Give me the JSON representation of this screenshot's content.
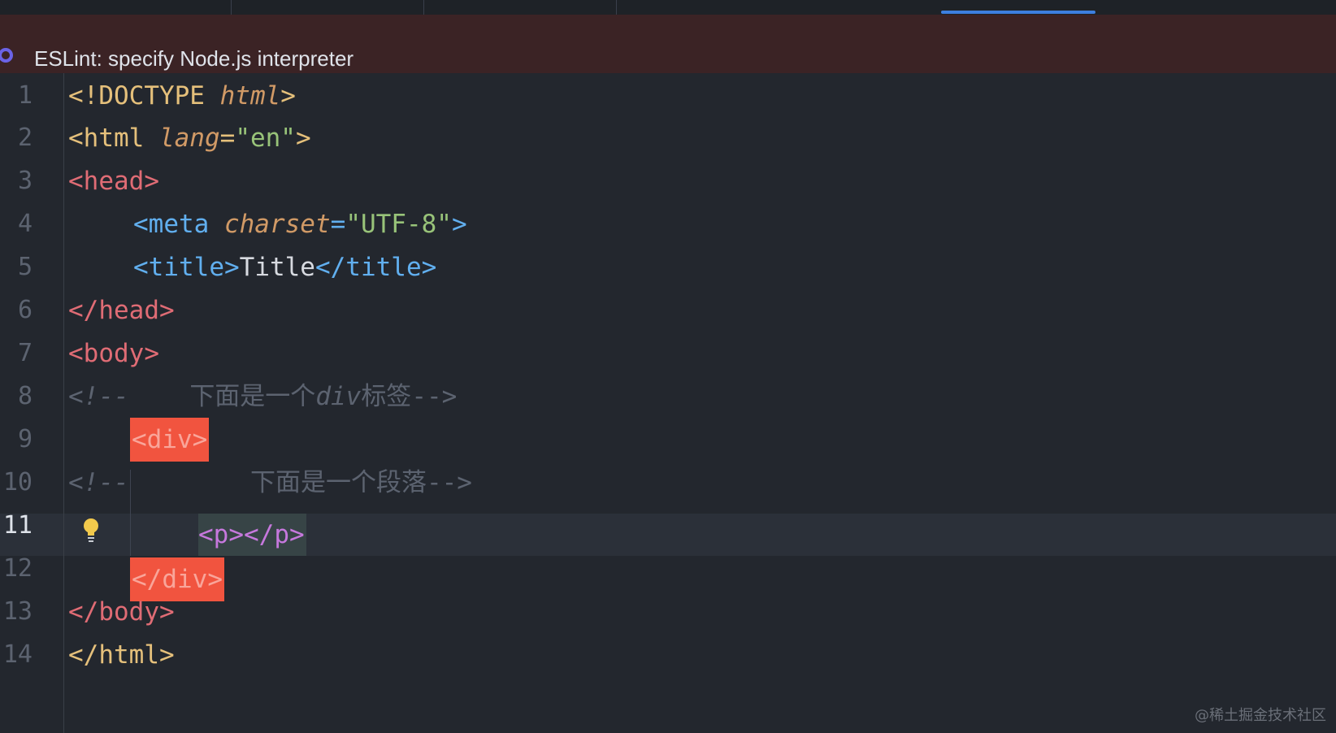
{
  "banner": {
    "message": "ESLint: specify Node.js interpreter",
    "icon": "eslint-icon"
  },
  "editor": {
    "current_line": 11,
    "lines": [
      {
        "number": "1"
      },
      {
        "number": "2"
      },
      {
        "number": "3"
      },
      {
        "number": "4"
      },
      {
        "number": "5"
      },
      {
        "number": "6"
      },
      {
        "number": "7"
      },
      {
        "number": "8"
      },
      {
        "number": "9"
      },
      {
        "number": "10"
      },
      {
        "number": "11"
      },
      {
        "number": "12"
      },
      {
        "number": "13"
      },
      {
        "number": "14"
      }
    ],
    "code": {
      "l1_open": "<!DOCTYPE ",
      "l1_html": "html",
      "l1_close": ">",
      "l2_tag": "<html ",
      "l2_attr": "lang",
      "l2_eq": "=",
      "l2_val": "\"en\"",
      "l2_close": ">",
      "l3": "<head>",
      "l4_tag": "<meta ",
      "l4_attr": "charset",
      "l4_eq": "=",
      "l4_val": "\"UTF-8\"",
      "l4_close": ">",
      "l5_open": "<title>",
      "l5_text": "Title",
      "l5_close": "</title>",
      "l6": "</head>",
      "l7": "<body>",
      "l8_open": "<!--",
      "l8_pad": "    ",
      "l8_cn1": "下面是一个",
      "l8_word": "div",
      "l8_cn2": "标签",
      "l8_close": "-->",
      "l9": "<div>",
      "l10_open": "<!--",
      "l10_pad": "        ",
      "l10_cn": "下面是一个段落",
      "l10_close": "-->",
      "l11": "<p></p>",
      "l12": "</div>",
      "l13": "</body>",
      "l14": "</html>"
    }
  },
  "watermark": "@稀土掘金技术社区",
  "colors": {
    "background": "#23272e",
    "banner": "#3b2325",
    "tag_yellow": "#e5c07b",
    "tag_red": "#e06c75",
    "tag_blue": "#61afef",
    "string": "#98c379",
    "attribute": "#d19a66",
    "comment": "#5c6370",
    "error_highlight": "#f1543f",
    "match_highlight": "#374446",
    "active_tab": "#3d7fe0"
  }
}
